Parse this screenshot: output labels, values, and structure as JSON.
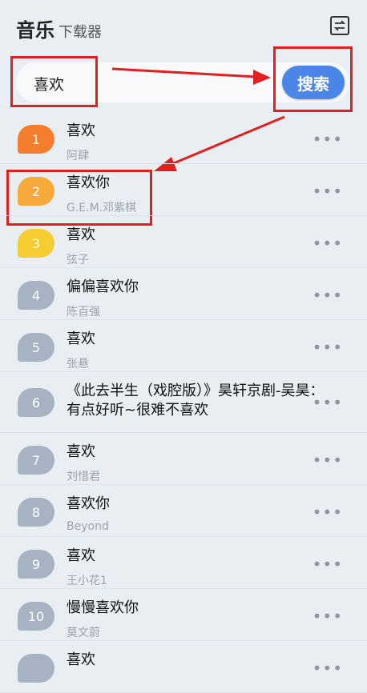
{
  "header": {
    "title": "音乐",
    "subtitle": "下载器",
    "switch_icon": "swap-icon"
  },
  "search": {
    "value": "喜欢",
    "button_label": "搜索"
  },
  "colors": {
    "accent": "#4a86e8",
    "annotation": "#e02020"
  },
  "songs": [
    {
      "rank": "1",
      "title": "喜欢",
      "artist": "阿肆",
      "badge_color": "#f47e2e"
    },
    {
      "rank": "2",
      "title": "喜欢你",
      "artist": "G.E.M.邓紫棋",
      "badge_color": "#f7a93a"
    },
    {
      "rank": "3",
      "title": "喜欢",
      "artist": "弦子",
      "badge_color": "#f5cd33"
    },
    {
      "rank": "4",
      "title": "偏偏喜欢你",
      "artist": "陈百强",
      "badge_color": "#a7b3c3"
    },
    {
      "rank": "5",
      "title": "喜欢",
      "artist": "张悬",
      "badge_color": "#a7b3c3"
    },
    {
      "rank": "6",
      "title": "《此去半生（戏腔版）》昊轩京剧-吴昊：有点好听~很难不喜欢",
      "artist": "",
      "badge_color": "#a7b3c3"
    },
    {
      "rank": "7",
      "title": "喜欢",
      "artist": "刘惜君",
      "badge_color": "#a7b3c3"
    },
    {
      "rank": "8",
      "title": "喜欢你",
      "artist": "Beyond",
      "badge_color": "#a7b3c3"
    },
    {
      "rank": "9",
      "title": "喜欢",
      "artist": "王小花1",
      "badge_color": "#a7b3c3"
    },
    {
      "rank": "10",
      "title": "慢慢喜欢你",
      "artist": "莫文蔚",
      "badge_color": "#a7b3c3"
    },
    {
      "rank": "",
      "title": "喜欢",
      "artist": "",
      "badge_color": "#a7b3c3"
    }
  ],
  "more_label": "•••"
}
